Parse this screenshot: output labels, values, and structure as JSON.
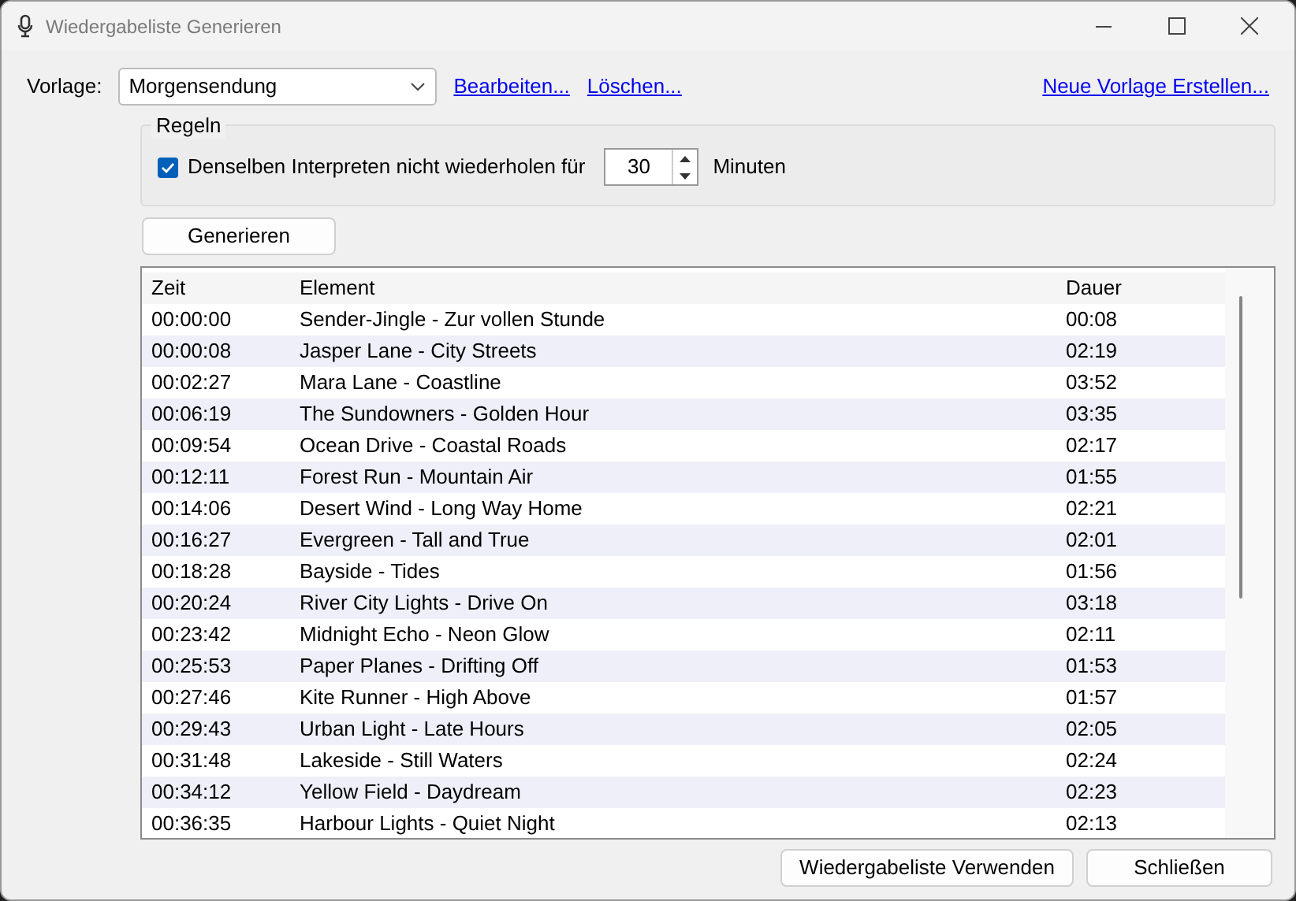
{
  "window": {
    "title": "Wiedergabeliste Generieren"
  },
  "template": {
    "label": "Vorlage:",
    "value": "Morgensendung",
    "links": [
      "Bearbeiten...",
      "Löschen..."
    ],
    "new_link": "Neue Vorlage Erstellen..."
  },
  "rules": {
    "title": "Regeln",
    "checkbox_label": "Denselben Interpreten nicht wiederholen für",
    "checked": true,
    "minutes": "30",
    "unit": "Minuten"
  },
  "generate_button": "Generieren",
  "table": {
    "columns": [
      "Zeit",
      "Element",
      "Dauer"
    ],
    "rows": [
      [
        "00:00:00",
        "Sender-Jingle - Zur vollen Stunde",
        "00:08"
      ],
      [
        "00:00:08",
        "Jasper Lane - City Streets",
        "02:19"
      ],
      [
        "00:02:27",
        "Mara Lane - Coastline",
        "03:52"
      ],
      [
        "00:06:19",
        "The Sundowners - Golden Hour",
        "03:35"
      ],
      [
        "00:09:54",
        "Ocean Drive - Coastal Roads",
        "02:17"
      ],
      [
        "00:12:11",
        "Forest Run - Mountain Air",
        "01:55"
      ],
      [
        "00:14:06",
        "Desert Wind - Long Way Home",
        "02:21"
      ],
      [
        "00:16:27",
        "Evergreen - Tall and True",
        "02:01"
      ],
      [
        "00:18:28",
        "Bayside - Tides",
        "01:56"
      ],
      [
        "00:20:24",
        "River City Lights - Drive On",
        "03:18"
      ],
      [
        "00:23:42",
        "Midnight Echo - Neon Glow",
        "02:11"
      ],
      [
        "00:25:53",
        "Paper Planes - Drifting Off",
        "01:53"
      ],
      [
        "00:27:46",
        "Kite Runner - High Above",
        "01:57"
      ],
      [
        "00:29:43",
        "Urban Light - Late Hours",
        "02:05"
      ],
      [
        "00:31:48",
        "Lakeside - Still Waters",
        "02:24"
      ],
      [
        "00:34:12",
        "Yellow Field - Daydream",
        "02:23"
      ],
      [
        "00:36:35",
        "Harbour Lights - Quiet Night",
        "02:13"
      ]
    ]
  },
  "buttons": [
    "Wiedergabeliste Verwenden",
    "Schließen"
  ]
}
